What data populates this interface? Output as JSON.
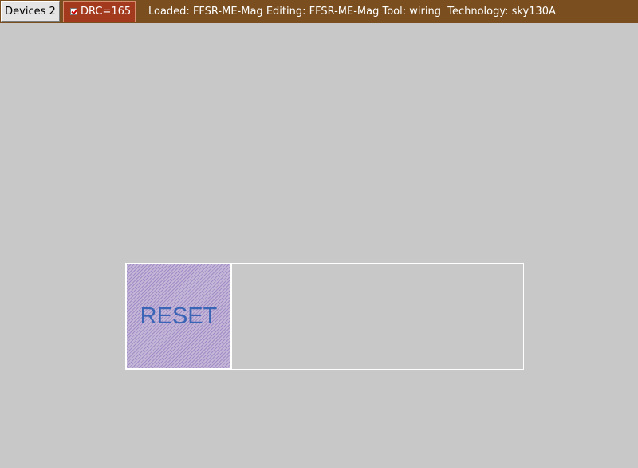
{
  "toolbar": {
    "devices_label": "Devices 2",
    "drc": {
      "label": "DRC=165",
      "checked": true
    },
    "status": {
      "loaded": "Loaded: FFSR-ME-Mag",
      "editing": "Editing: FFSR-ME-Mag",
      "tool": "Tool: wiring",
      "technology": "Technology: sky130A"
    }
  },
  "layout": {
    "pad_label": "RESET"
  },
  "colors": {
    "toolbar_bg": "#7a4e1e",
    "drc_bg": "#a33a1e",
    "canvas_bg": "#c8c8c8",
    "pad_fill": "#c3b6d6",
    "pad_label": "#3a64b6",
    "outline": "#ffffff"
  },
  "icons": {
    "drc_checkbox": "checkbox-checked-icon"
  }
}
